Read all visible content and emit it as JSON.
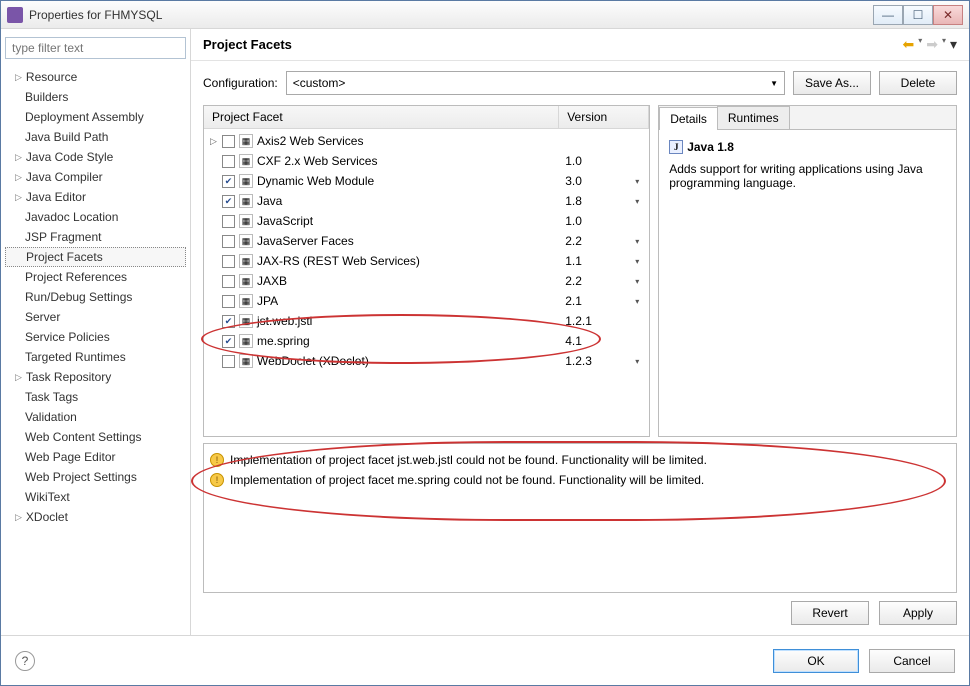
{
  "window": {
    "title": "Properties for FHMYSQL"
  },
  "sidebar": {
    "filter_placeholder": "type filter text",
    "items": [
      {
        "label": "Resource",
        "exp": true
      },
      {
        "label": "Builders",
        "exp": false
      },
      {
        "label": "Deployment Assembly",
        "exp": false
      },
      {
        "label": "Java Build Path",
        "exp": false
      },
      {
        "label": "Java Code Style",
        "exp": true
      },
      {
        "label": "Java Compiler",
        "exp": true
      },
      {
        "label": "Java Editor",
        "exp": true
      },
      {
        "label": "Javadoc Location",
        "exp": false
      },
      {
        "label": "JSP Fragment",
        "exp": false
      },
      {
        "label": "Project Facets",
        "exp": false,
        "selected": true
      },
      {
        "label": "Project References",
        "exp": false
      },
      {
        "label": "Run/Debug Settings",
        "exp": false
      },
      {
        "label": "Server",
        "exp": false
      },
      {
        "label": "Service Policies",
        "exp": false
      },
      {
        "label": "Targeted Runtimes",
        "exp": false
      },
      {
        "label": "Task Repository",
        "exp": true
      },
      {
        "label": "Task Tags",
        "exp": false
      },
      {
        "label": "Validation",
        "exp": false
      },
      {
        "label": "Web Content Settings",
        "exp": false
      },
      {
        "label": "Web Page Editor",
        "exp": false
      },
      {
        "label": "Web Project Settings",
        "exp": false
      },
      {
        "label": "WikiText",
        "exp": false
      },
      {
        "label": "XDoclet",
        "exp": true
      }
    ]
  },
  "page": {
    "title": "Project Facets",
    "config_label": "Configuration:",
    "config_value": "<custom>",
    "save_as": "Save As...",
    "delete": "Delete",
    "revert": "Revert",
    "apply": "Apply",
    "ok": "OK",
    "cancel": "Cancel"
  },
  "facet_header": {
    "name": "Project Facet",
    "version": "Version"
  },
  "facets": [
    {
      "arrow": "▷",
      "checked": false,
      "name": "Axis2 Web Services",
      "ver": "",
      "dd": false
    },
    {
      "arrow": "",
      "checked": false,
      "name": "CXF 2.x Web Services",
      "ver": "1.0",
      "dd": false
    },
    {
      "arrow": "",
      "checked": true,
      "name": "Dynamic Web Module",
      "ver": "3.0",
      "dd": true
    },
    {
      "arrow": "",
      "checked": true,
      "name": "Java",
      "ver": "1.8",
      "dd": true
    },
    {
      "arrow": "",
      "checked": false,
      "name": "JavaScript",
      "ver": "1.0",
      "dd": false
    },
    {
      "arrow": "",
      "checked": false,
      "name": "JavaServer Faces",
      "ver": "2.2",
      "dd": true
    },
    {
      "arrow": "",
      "checked": false,
      "name": "JAX-RS (REST Web Services)",
      "ver": "1.1",
      "dd": true
    },
    {
      "arrow": "",
      "checked": false,
      "name": "JAXB",
      "ver": "2.2",
      "dd": true
    },
    {
      "arrow": "",
      "checked": false,
      "name": "JPA",
      "ver": "2.1",
      "dd": true
    },
    {
      "arrow": "",
      "checked": true,
      "name": "jst.web.jstl",
      "ver": "1.2.1",
      "dd": false
    },
    {
      "arrow": "",
      "checked": true,
      "name": "me.spring",
      "ver": "4.1",
      "dd": false
    },
    {
      "arrow": "",
      "checked": false,
      "name": "WebDoclet (XDoclet)",
      "ver": "1.2.3",
      "dd": true
    }
  ],
  "details": {
    "tab_details": "Details",
    "tab_runtimes": "Runtimes",
    "heading": "Java 1.8",
    "body": "Adds support for writing applications using Java programming language."
  },
  "warnings": [
    "Implementation of project facet jst.web.jstl could not be found. Functionality will be limited.",
    "Implementation of project facet me.spring could not be found. Functionality will be limited."
  ]
}
